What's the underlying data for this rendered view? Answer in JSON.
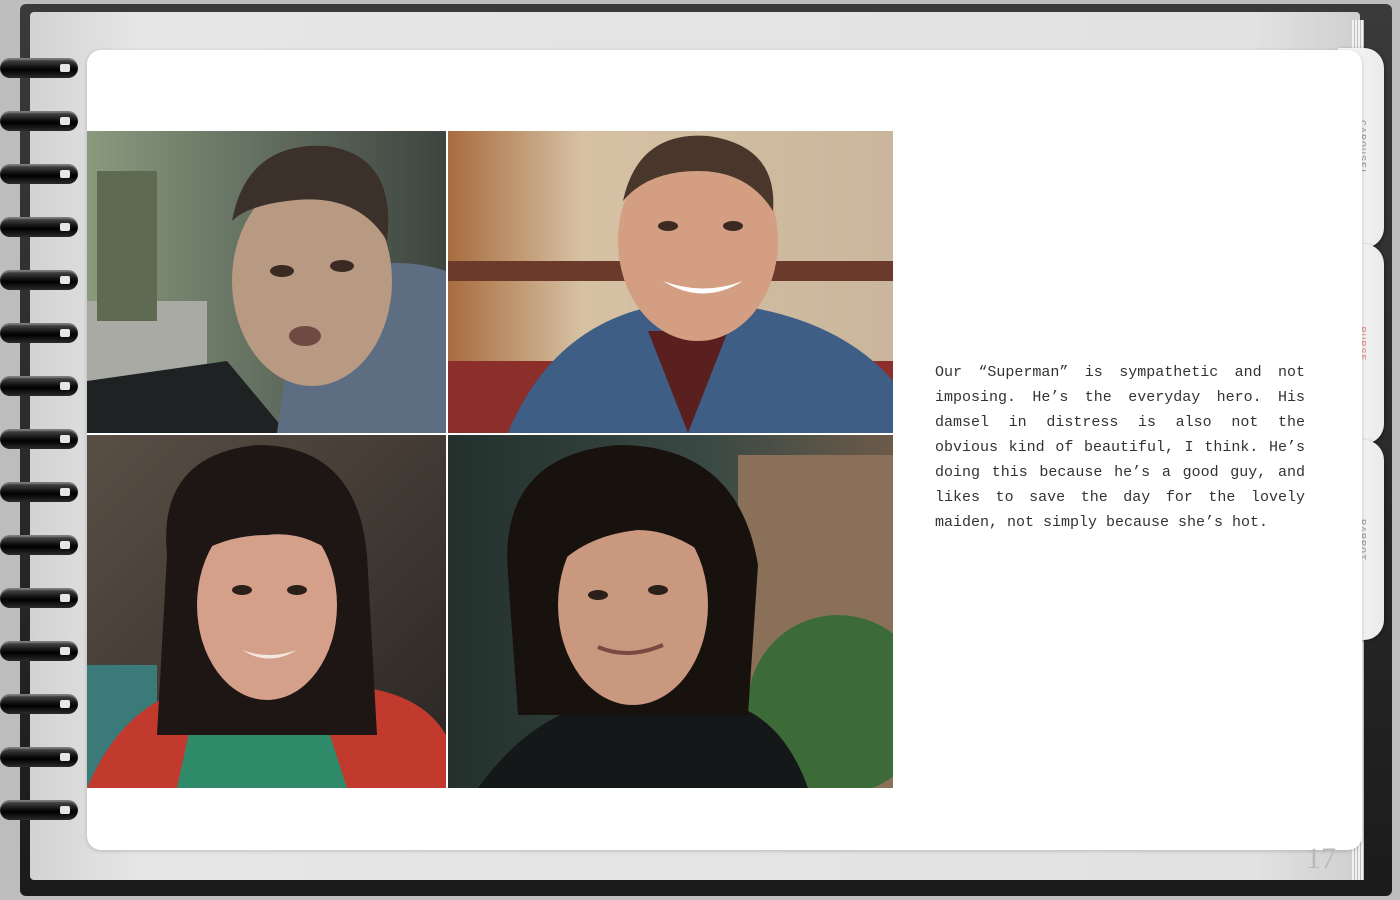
{
  "tabs": [
    "CAROUSEL",
    "PURSE",
    "PARROT"
  ],
  "active_tab": "PURSE",
  "body_text": "Our “Superman” is sympathetic and not imposing.  He’s the everyday hero. His damsel in distress is also not the obvious kind of beautiful, I think.  He’s doing this because he’s a good guy, and likes to save the day for the lovely maiden, not simply be­cause she’s hot.",
  "page_number": "17"
}
